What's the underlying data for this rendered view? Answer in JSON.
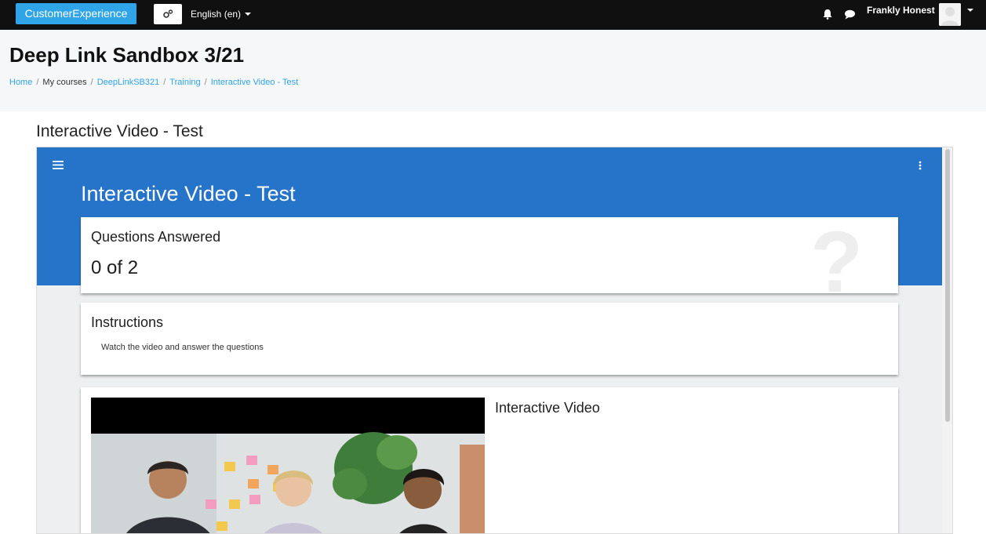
{
  "navbar": {
    "brand": "CustomerExperience",
    "language": "English (en)",
    "username": "Frankly Honest",
    "icons": [
      "gears-icon",
      "bell-icon",
      "chat-icon",
      "avatar",
      "chevron-down-icon"
    ]
  },
  "header": {
    "course_title": "Deep Link Sandbox 3/21",
    "breadcrumb": [
      "Home",
      "My courses",
      "DeepLinkSB321",
      "Training",
      "Interactive Video - Test"
    ]
  },
  "activity": {
    "title": "Interactive Video - Test"
  },
  "h5p": {
    "title": "Interactive Video - Test",
    "questions_label": "Questions Answered",
    "questions_value": "0 of 2",
    "instructions_label": "Instructions",
    "instructions_text": "Watch the video and answer the questions",
    "video_label": "Interactive Video"
  },
  "colors": {
    "brand": "#2fa4e7",
    "navbar": "#101010",
    "h5p_blue": "#2674c9"
  }
}
